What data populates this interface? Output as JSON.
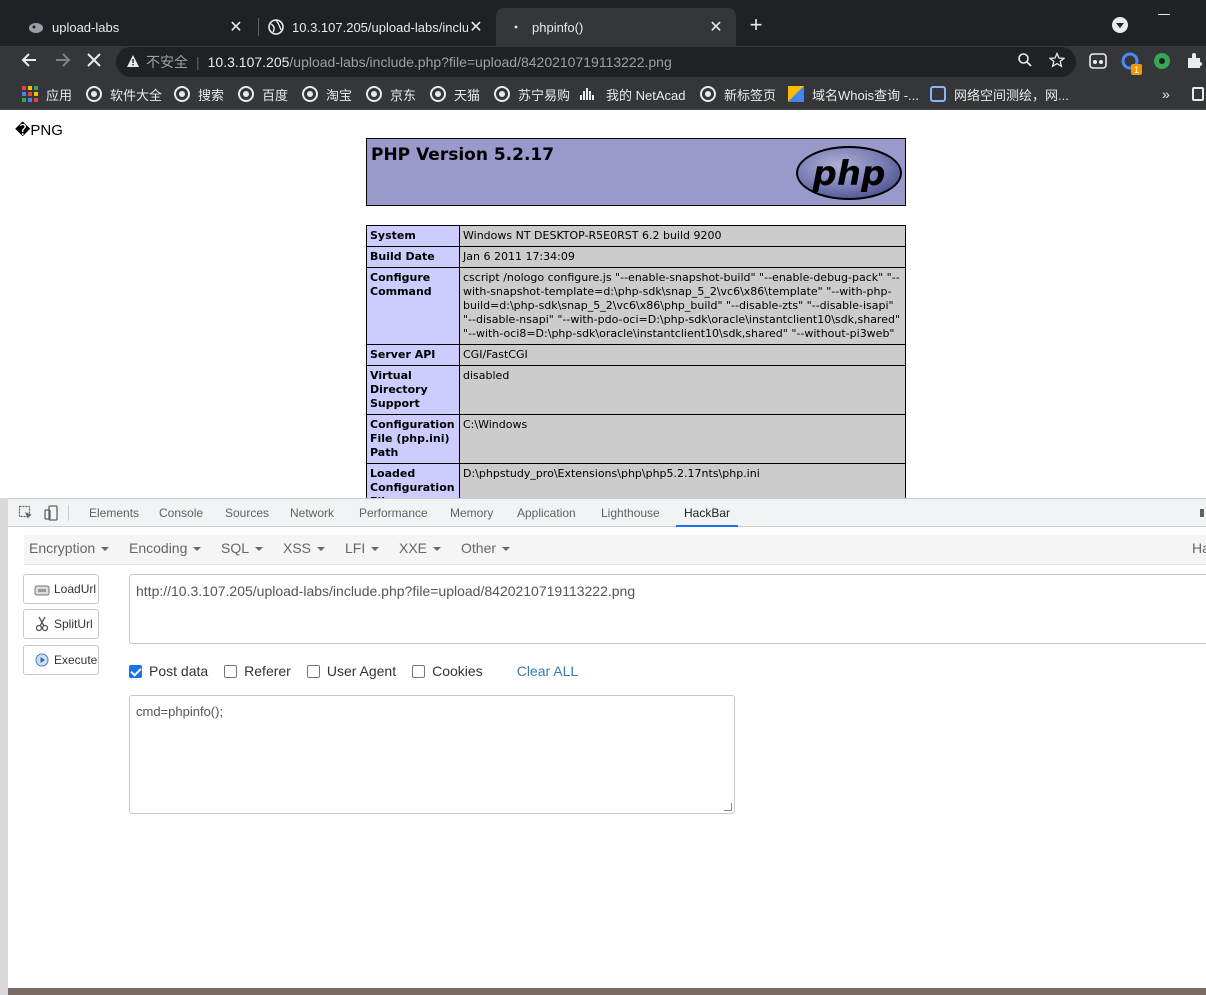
{
  "tabs": [
    {
      "title": "upload-labs",
      "active": false
    },
    {
      "title": "10.3.107.205/upload-labs/inclu",
      "active": false
    },
    {
      "title": "phpinfo()",
      "active": true
    }
  ],
  "toolbar": {
    "security_label": "不安全",
    "url_host": "10.3.107.205",
    "url_path": "/upload-labs/include.php?file=upload/8420210719113222.png",
    "badge_count": "1"
  },
  "bookmarks": [
    "应用",
    "软件大全",
    "搜索",
    "百度",
    "淘宝",
    "京东",
    "天猫",
    "苏宁易购",
    "我的 NetAcad",
    "新标签页",
    "域名Whois查询 -...",
    "网络空间测绘，网..."
  ],
  "page": {
    "png_text": "�PNG ",
    "php_version": "PHP Version 5.2.17",
    "php_logo_text": "php",
    "rows": [
      {
        "key": "System",
        "value": "Windows NT DESKTOP-R5E0RST 6.2 build 9200"
      },
      {
        "key": "Build Date",
        "value": "Jan 6 2011 17:34:09"
      },
      {
        "key": "Configure Command",
        "value": "cscript /nologo configure.js \"--enable-snapshot-build\" \"--enable-debug-pack\" \"--with-snapshot-template=d:\\php-sdk\\snap_5_2\\vc6\\x86\\template\" \"--with-php-build=d:\\php-sdk\\snap_5_2\\vc6\\x86\\php_build\" \"--disable-zts\" \"--disable-isapi\" \"--disable-nsapi\" \"--with-pdo-oci=D:\\php-sdk\\oracle\\instantclient10\\sdk,shared\" \"--with-oci8=D:\\php-sdk\\oracle\\instantclient10\\sdk,shared\" \"--without-pi3web\""
      },
      {
        "key": "Server API",
        "value": "CGI/FastCGI"
      },
      {
        "key": "Virtual Directory Support",
        "value": "disabled"
      },
      {
        "key": "Configuration File (php.ini) Path",
        "value": "C:\\Windows"
      },
      {
        "key": "Loaded Configuration File",
        "value": "D:\\phpstudy_pro\\Extensions\\php\\php5.2.17nts\\php.ini"
      }
    ]
  },
  "devtools": {
    "tabs": [
      "Elements",
      "Console",
      "Sources",
      "Network",
      "Performance",
      "Memory",
      "Application",
      "Lighthouse",
      "HackBar"
    ],
    "active_tab": "HackBar"
  },
  "hackbar": {
    "menus": [
      "Encryption",
      "Encoding",
      "SQL",
      "XSS",
      "LFI",
      "XXE",
      "Other"
    ],
    "right_label": "Ha",
    "buttons": {
      "load": "LoadUrl",
      "split": "SplitUrl",
      "execute": "Execute"
    },
    "url_value": "http://10.3.107.205/upload-labs/include.php?file=upload/8420210719113222.png",
    "options": {
      "post": "Post data",
      "referer": "Referer",
      "ua": "User Agent",
      "cookies": "Cookies",
      "clear": "Clear ALL"
    },
    "post_value": "cmd=phpinfo();"
  },
  "colors": {
    "accent": "#1a73e8",
    "php_header": "#9999cc",
    "php_key": "#ccccff",
    "php_value": "#cccccc",
    "link": "#337ab7"
  }
}
